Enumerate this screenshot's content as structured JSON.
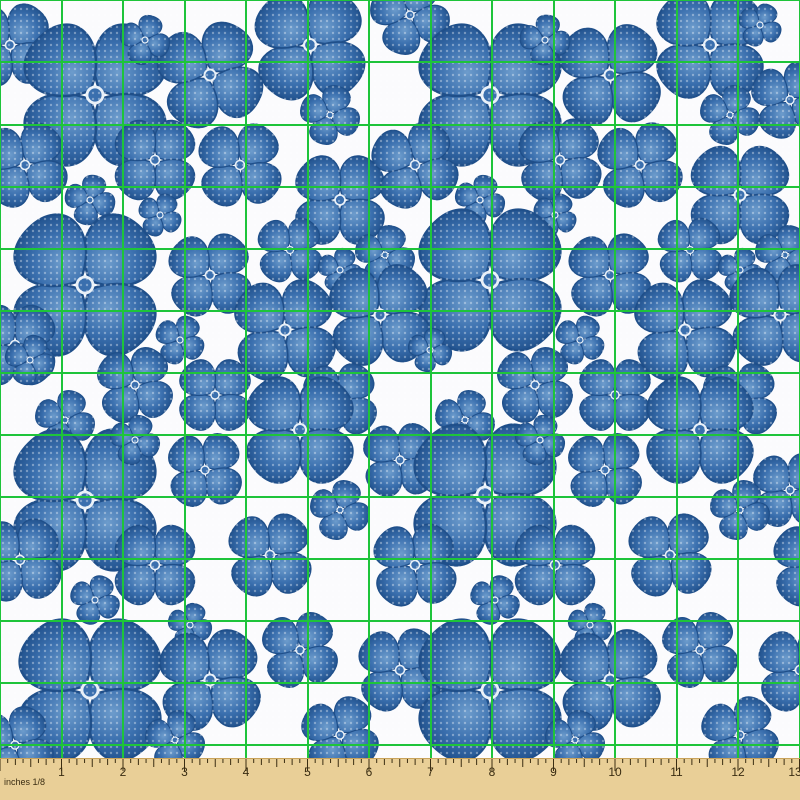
{
  "fabric": {
    "background_color": "#fbfbfd",
    "flower_color_dark": "#1f4f8a",
    "flower_color_mid": "#3a6fae",
    "flower_color_light": "#6d9ccc",
    "flower_center_ring": "#e8f0f8",
    "motif": "four-petal-flower-icon",
    "texture": "woven-dot"
  },
  "grid": {
    "line_color": "#1ec43a",
    "columns": 13,
    "rows": 12
  },
  "ruler": {
    "unit_label": "inches 1/8",
    "ticks": [
      "1",
      "2",
      "3",
      "4",
      "5",
      "6",
      "7",
      "8",
      "9",
      "10",
      "11",
      "12",
      "13"
    ],
    "background_color": "#e9cf97",
    "edge_color": "#c9a35c",
    "text_color": "#3a2d12"
  }
}
